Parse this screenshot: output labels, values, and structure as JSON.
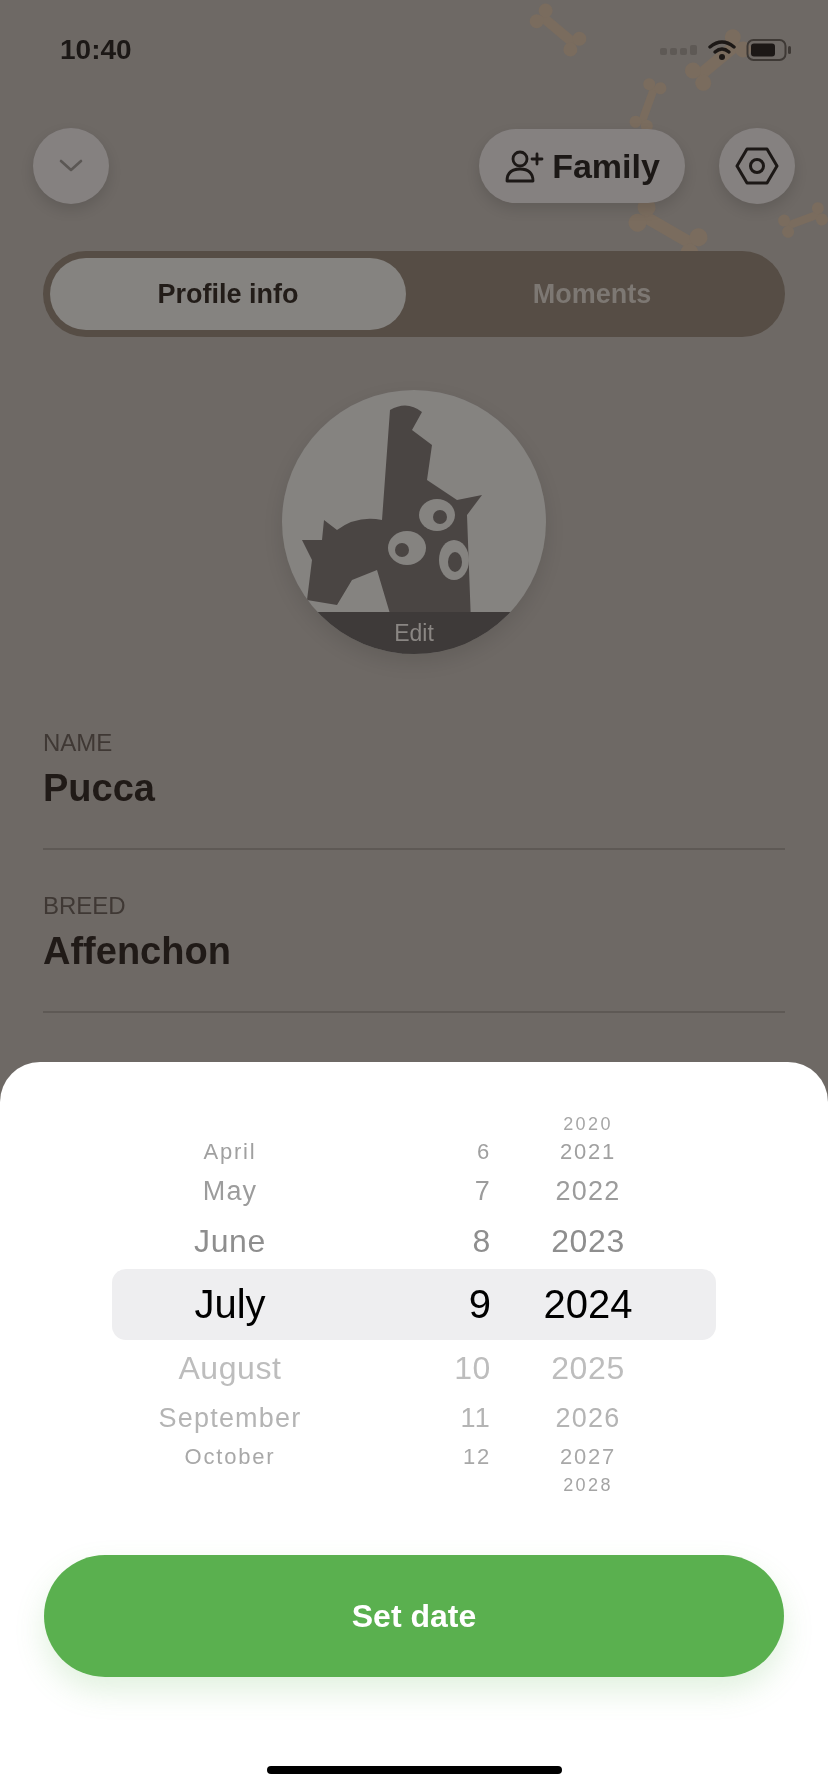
{
  "status_bar": {
    "time": "10:40"
  },
  "header": {
    "family_button": "Family"
  },
  "tabs": [
    {
      "label": "Profile info",
      "selected": true
    },
    {
      "label": "Moments",
      "selected": false
    }
  ],
  "avatar": {
    "edit_label": "Edit"
  },
  "fields": [
    {
      "label": "NAME",
      "value": "Pucca"
    },
    {
      "label": "BREED",
      "value": "Affenchon"
    }
  ],
  "date_picker": {
    "columns": [
      {
        "kind": "month",
        "items": [
          {
            "label": "April",
            "selected": false
          },
          {
            "label": "May",
            "selected": false
          },
          {
            "label": "June",
            "selected": false
          },
          {
            "label": "July",
            "selected": true
          },
          {
            "label": "August",
            "selected": false
          },
          {
            "label": "September",
            "selected": false
          },
          {
            "label": "October",
            "selected": false
          }
        ]
      },
      {
        "kind": "day",
        "items": [
          {
            "label": "6",
            "selected": false
          },
          {
            "label": "7",
            "selected": false
          },
          {
            "label": "8",
            "selected": false
          },
          {
            "label": "9",
            "selected": true
          },
          {
            "label": "10",
            "selected": false
          },
          {
            "label": "11",
            "selected": false
          },
          {
            "label": "12",
            "selected": false
          }
        ]
      },
      {
        "kind": "year",
        "items": [
          {
            "label": "2020",
            "selected": false
          },
          {
            "label": "2021",
            "selected": false
          },
          {
            "label": "2022",
            "selected": false
          },
          {
            "label": "2023",
            "selected": false
          },
          {
            "label": "2024",
            "selected": true
          },
          {
            "label": "2025",
            "selected": false
          },
          {
            "label": "2026",
            "selected": false
          },
          {
            "label": "2027",
            "selected": false
          },
          {
            "label": "2028",
            "selected": false
          }
        ]
      }
    ]
  },
  "set_button": "Set date"
}
